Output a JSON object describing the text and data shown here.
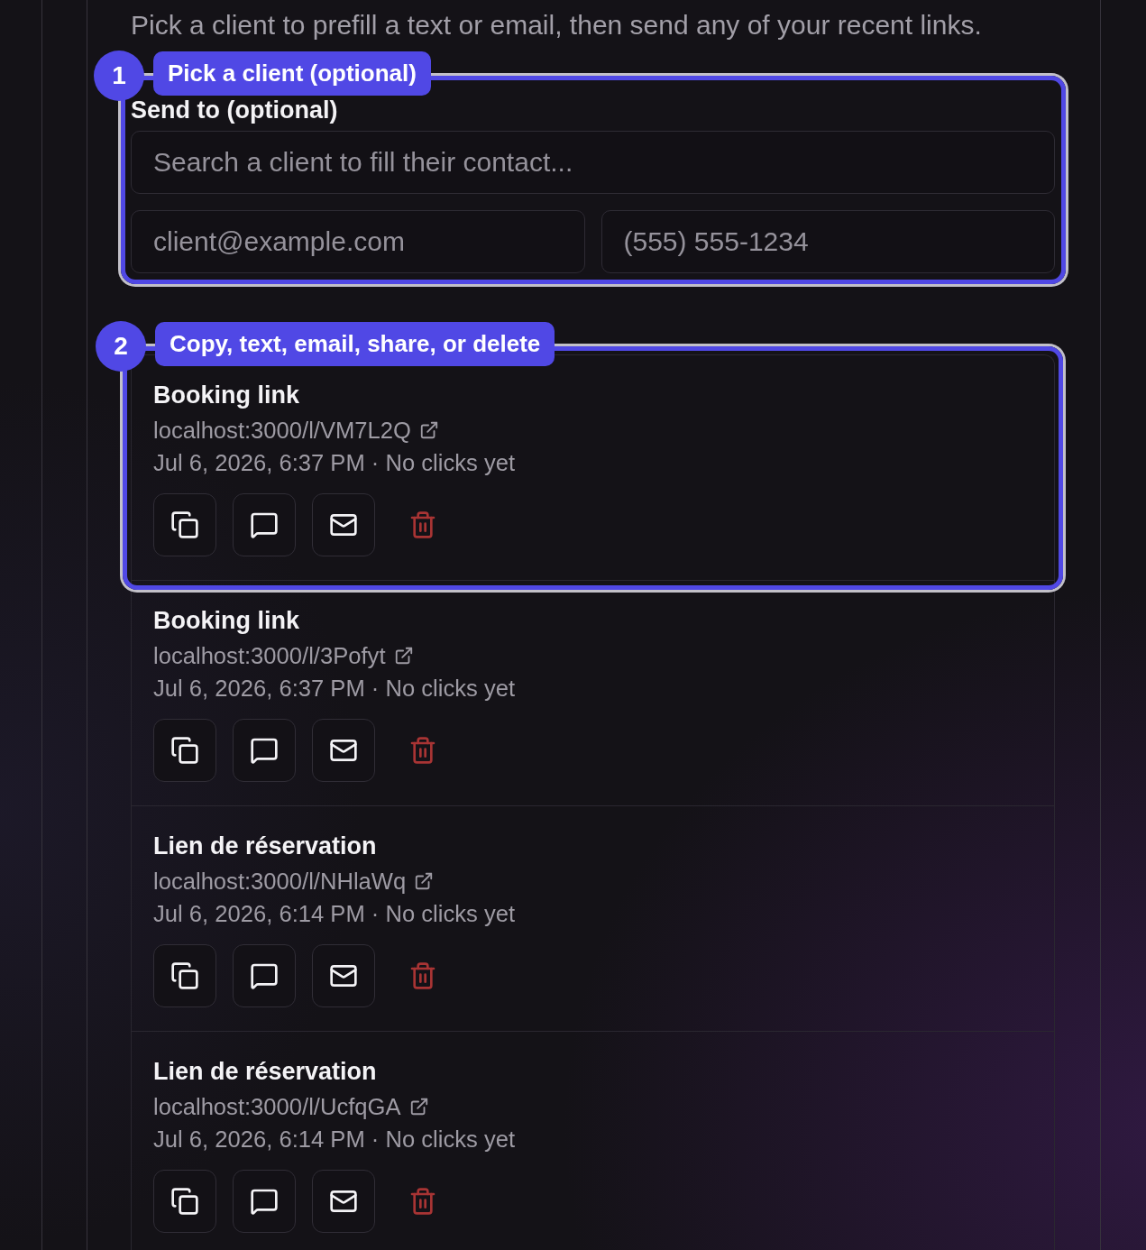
{
  "intro": {
    "text": "Pick a client to prefill a text or email, then send any of your recent links."
  },
  "send_to": {
    "label": "Send to (optional)",
    "tour_step": {
      "number": "1",
      "label": "Pick a client (optional)"
    },
    "search_field": {
      "placeholder": "Search a client to fill their contact..."
    },
    "email_field": {
      "placeholder": "client@example.com"
    },
    "phone_field": {
      "placeholder": "(555) 555-1234"
    }
  },
  "recent_links": {
    "tour_step": {
      "number": "2",
      "label": "Copy, text, email, share, or delete"
    },
    "items": [
      {
        "title": "Booking link",
        "url": "localhost:3000/l/VM7L2Q",
        "meta": "Jul 6, 2026, 6:37 PM · No clicks yet"
      },
      {
        "title": "Booking link",
        "url": "localhost:3000/l/3Pofyt",
        "meta": "Jul 6, 2026, 6:37 PM · No clicks yet"
      },
      {
        "title": "Lien de réservation",
        "url": "localhost:3000/l/NHlaWq",
        "meta": "Jul 6, 2026, 6:14 PM · No clicks yet"
      },
      {
        "title": "Lien de réservation",
        "url": "localhost:3000/l/UcfqGA",
        "meta": "Jul 6, 2026, 6:14 PM · No clicks yet"
      }
    ]
  }
}
